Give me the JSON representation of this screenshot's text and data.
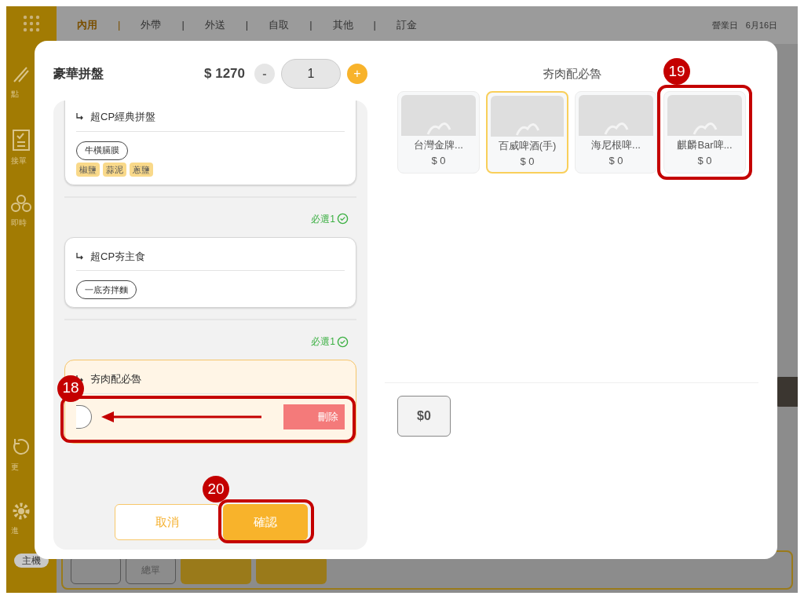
{
  "top_bar": {
    "tabs": [
      {
        "label": "內用",
        "selected": true
      },
      {
        "label": "外帶",
        "selected": false
      },
      {
        "label": "外送",
        "selected": false
      },
      {
        "label": "自取",
        "selected": false
      },
      {
        "label": "其他",
        "selected": false
      },
      {
        "label": "訂金",
        "selected": false
      }
    ],
    "separator": "|",
    "business_day_label": "營業日",
    "date": "6月16日"
  },
  "sidebar": {
    "items": [
      {
        "kind": "knife",
        "label": "點"
      },
      {
        "kind": "clipboard",
        "label": "接單"
      },
      {
        "kind": "people",
        "label": "即時"
      },
      {
        "kind": "refresh",
        "label": "更"
      },
      {
        "kind": "gear",
        "label": "進"
      }
    ],
    "host_badge": "主機"
  },
  "bottom_bar": {
    "buttons": [
      {
        "kind": "outline"
      },
      {
        "kind": "outline",
        "label": "總單"
      },
      {
        "kind": "filled"
      },
      {
        "kind": "filled"
      }
    ]
  },
  "dialog": {
    "title": "豪華拼盤",
    "price": "$ 1270",
    "quantity": {
      "minus": "-",
      "value": "1",
      "plus": "+"
    },
    "groups": [
      {
        "title": "超CP經典拼盤",
        "active": false,
        "options": [
          "牛橫膈膜"
        ],
        "tags": [
          "椒鹽",
          "蒜泥",
          "蔥鹽"
        ]
      },
      {
        "required": "必選1",
        "title": "超CP夯主食",
        "active": false,
        "options": [
          "一底夯拌麵"
        ]
      },
      {
        "required": "必選1",
        "title": "夯肉配必魯",
        "active": true,
        "swipe_row": {
          "delete": "刪除",
          "callout": "18"
        }
      }
    ],
    "cancel": "取消",
    "confirm": {
      "label": "確認",
      "callout": "20"
    },
    "picker": {
      "title": "夯肉配必魯",
      "products": [
        {
          "name": "台灣金牌...",
          "price": "$ 0",
          "selected": false
        },
        {
          "name": "百威啤酒(手)",
          "price": "$ 0",
          "selected": true
        },
        {
          "name": "海尼根啤...",
          "price": "$ 0",
          "selected": false
        },
        {
          "name": "麒麟Bar啤...",
          "price": "$ 0",
          "selected": false,
          "callout": "19"
        }
      ],
      "amount": "$0"
    }
  }
}
